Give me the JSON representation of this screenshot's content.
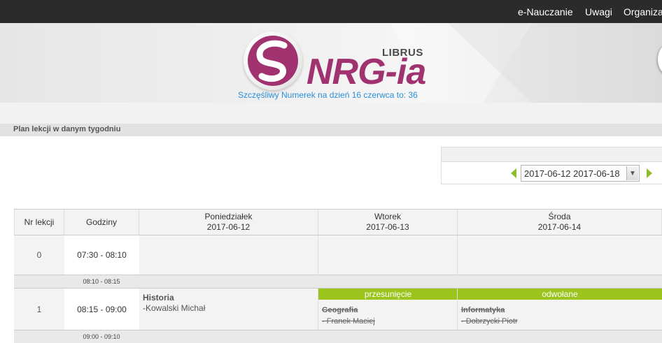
{
  "topnav": {
    "items": [
      {
        "label": "e-Nauczanie"
      },
      {
        "label": "Uwagi"
      },
      {
        "label": "Organiza"
      }
    ]
  },
  "banner": {
    "brand_small": "LIBRUS",
    "brand_big": "NRG-ia",
    "lucky_number": "Szczęśliwy Numerek na dzień 16 czerwca to: 36"
  },
  "section": {
    "title": "Plan lekcji w danym tygodniu"
  },
  "week_selector": {
    "value": "2017-06-12 2017-06-18",
    "prev_icon": "arrow-left-icon",
    "next_icon": "arrow-right-icon",
    "accent": "#8cbf26"
  },
  "timetable": {
    "headers": {
      "nr": "Nr lekcji",
      "hours": "Godziny",
      "days": [
        {
          "name": "Poniedziałek",
          "date": "2017-06-12"
        },
        {
          "name": "Wtorek",
          "date": "2017-06-13"
        },
        {
          "name": "Środa",
          "date": "2017-06-14"
        }
      ]
    },
    "rows": [
      {
        "nr": "0",
        "time": "07:30 - 08:10"
      },
      {
        "nr": "1",
        "time": "08:15 - 09:00"
      }
    ],
    "breaks": [
      "08:10 - 08:15",
      "09:00 - 09:10"
    ],
    "lesson_1": {
      "monday": {
        "subject": "Historia",
        "teacher": "-Kowalski Michał"
      },
      "tuesday": {
        "status": "przesunięcie",
        "subject": "Geografia",
        "teacher": "- Franek Maciej"
      },
      "wednesday": {
        "status": "odwołane",
        "subject": "Informatyka",
        "teacher": "- Dobrzycki Piotr"
      }
    },
    "status_color": "#9bc41c"
  }
}
